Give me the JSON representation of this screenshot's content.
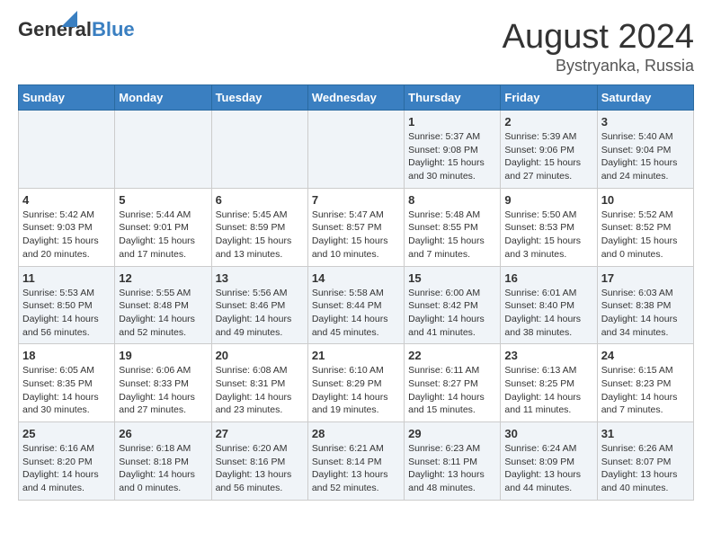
{
  "header": {
    "logo_general": "General",
    "logo_blue": "Blue",
    "month": "August 2024",
    "location": "Bystryanka, Russia"
  },
  "weekdays": [
    "Sunday",
    "Monday",
    "Tuesday",
    "Wednesday",
    "Thursday",
    "Friday",
    "Saturday"
  ],
  "weeks": [
    [
      {
        "day": "",
        "content": ""
      },
      {
        "day": "",
        "content": ""
      },
      {
        "day": "",
        "content": ""
      },
      {
        "day": "",
        "content": ""
      },
      {
        "day": "1",
        "content": "Sunrise: 5:37 AM\nSunset: 9:08 PM\nDaylight: 15 hours\nand 30 minutes."
      },
      {
        "day": "2",
        "content": "Sunrise: 5:39 AM\nSunset: 9:06 PM\nDaylight: 15 hours\nand 27 minutes."
      },
      {
        "day": "3",
        "content": "Sunrise: 5:40 AM\nSunset: 9:04 PM\nDaylight: 15 hours\nand 24 minutes."
      }
    ],
    [
      {
        "day": "4",
        "content": "Sunrise: 5:42 AM\nSunset: 9:03 PM\nDaylight: 15 hours\nand 20 minutes."
      },
      {
        "day": "5",
        "content": "Sunrise: 5:44 AM\nSunset: 9:01 PM\nDaylight: 15 hours\nand 17 minutes."
      },
      {
        "day": "6",
        "content": "Sunrise: 5:45 AM\nSunset: 8:59 PM\nDaylight: 15 hours\nand 13 minutes."
      },
      {
        "day": "7",
        "content": "Sunrise: 5:47 AM\nSunset: 8:57 PM\nDaylight: 15 hours\nand 10 minutes."
      },
      {
        "day": "8",
        "content": "Sunrise: 5:48 AM\nSunset: 8:55 PM\nDaylight: 15 hours\nand 7 minutes."
      },
      {
        "day": "9",
        "content": "Sunrise: 5:50 AM\nSunset: 8:53 PM\nDaylight: 15 hours\nand 3 minutes."
      },
      {
        "day": "10",
        "content": "Sunrise: 5:52 AM\nSunset: 8:52 PM\nDaylight: 15 hours\nand 0 minutes."
      }
    ],
    [
      {
        "day": "11",
        "content": "Sunrise: 5:53 AM\nSunset: 8:50 PM\nDaylight: 14 hours\nand 56 minutes."
      },
      {
        "day": "12",
        "content": "Sunrise: 5:55 AM\nSunset: 8:48 PM\nDaylight: 14 hours\nand 52 minutes."
      },
      {
        "day": "13",
        "content": "Sunrise: 5:56 AM\nSunset: 8:46 PM\nDaylight: 14 hours\nand 49 minutes."
      },
      {
        "day": "14",
        "content": "Sunrise: 5:58 AM\nSunset: 8:44 PM\nDaylight: 14 hours\nand 45 minutes."
      },
      {
        "day": "15",
        "content": "Sunrise: 6:00 AM\nSunset: 8:42 PM\nDaylight: 14 hours\nand 41 minutes."
      },
      {
        "day": "16",
        "content": "Sunrise: 6:01 AM\nSunset: 8:40 PM\nDaylight: 14 hours\nand 38 minutes."
      },
      {
        "day": "17",
        "content": "Sunrise: 6:03 AM\nSunset: 8:38 PM\nDaylight: 14 hours\nand 34 minutes."
      }
    ],
    [
      {
        "day": "18",
        "content": "Sunrise: 6:05 AM\nSunset: 8:35 PM\nDaylight: 14 hours\nand 30 minutes."
      },
      {
        "day": "19",
        "content": "Sunrise: 6:06 AM\nSunset: 8:33 PM\nDaylight: 14 hours\nand 27 minutes."
      },
      {
        "day": "20",
        "content": "Sunrise: 6:08 AM\nSunset: 8:31 PM\nDaylight: 14 hours\nand 23 minutes."
      },
      {
        "day": "21",
        "content": "Sunrise: 6:10 AM\nSunset: 8:29 PM\nDaylight: 14 hours\nand 19 minutes."
      },
      {
        "day": "22",
        "content": "Sunrise: 6:11 AM\nSunset: 8:27 PM\nDaylight: 14 hours\nand 15 minutes."
      },
      {
        "day": "23",
        "content": "Sunrise: 6:13 AM\nSunset: 8:25 PM\nDaylight: 14 hours\nand 11 minutes."
      },
      {
        "day": "24",
        "content": "Sunrise: 6:15 AM\nSunset: 8:23 PM\nDaylight: 14 hours\nand 7 minutes."
      }
    ],
    [
      {
        "day": "25",
        "content": "Sunrise: 6:16 AM\nSunset: 8:20 PM\nDaylight: 14 hours\nand 4 minutes."
      },
      {
        "day": "26",
        "content": "Sunrise: 6:18 AM\nSunset: 8:18 PM\nDaylight: 14 hours\nand 0 minutes."
      },
      {
        "day": "27",
        "content": "Sunrise: 6:20 AM\nSunset: 8:16 PM\nDaylight: 13 hours\nand 56 minutes."
      },
      {
        "day": "28",
        "content": "Sunrise: 6:21 AM\nSunset: 8:14 PM\nDaylight: 13 hours\nand 52 minutes."
      },
      {
        "day": "29",
        "content": "Sunrise: 6:23 AM\nSunset: 8:11 PM\nDaylight: 13 hours\nand 48 minutes."
      },
      {
        "day": "30",
        "content": "Sunrise: 6:24 AM\nSunset: 8:09 PM\nDaylight: 13 hours\nand 44 minutes."
      },
      {
        "day": "31",
        "content": "Sunrise: 6:26 AM\nSunset: 8:07 PM\nDaylight: 13 hours\nand 40 minutes."
      }
    ]
  ]
}
